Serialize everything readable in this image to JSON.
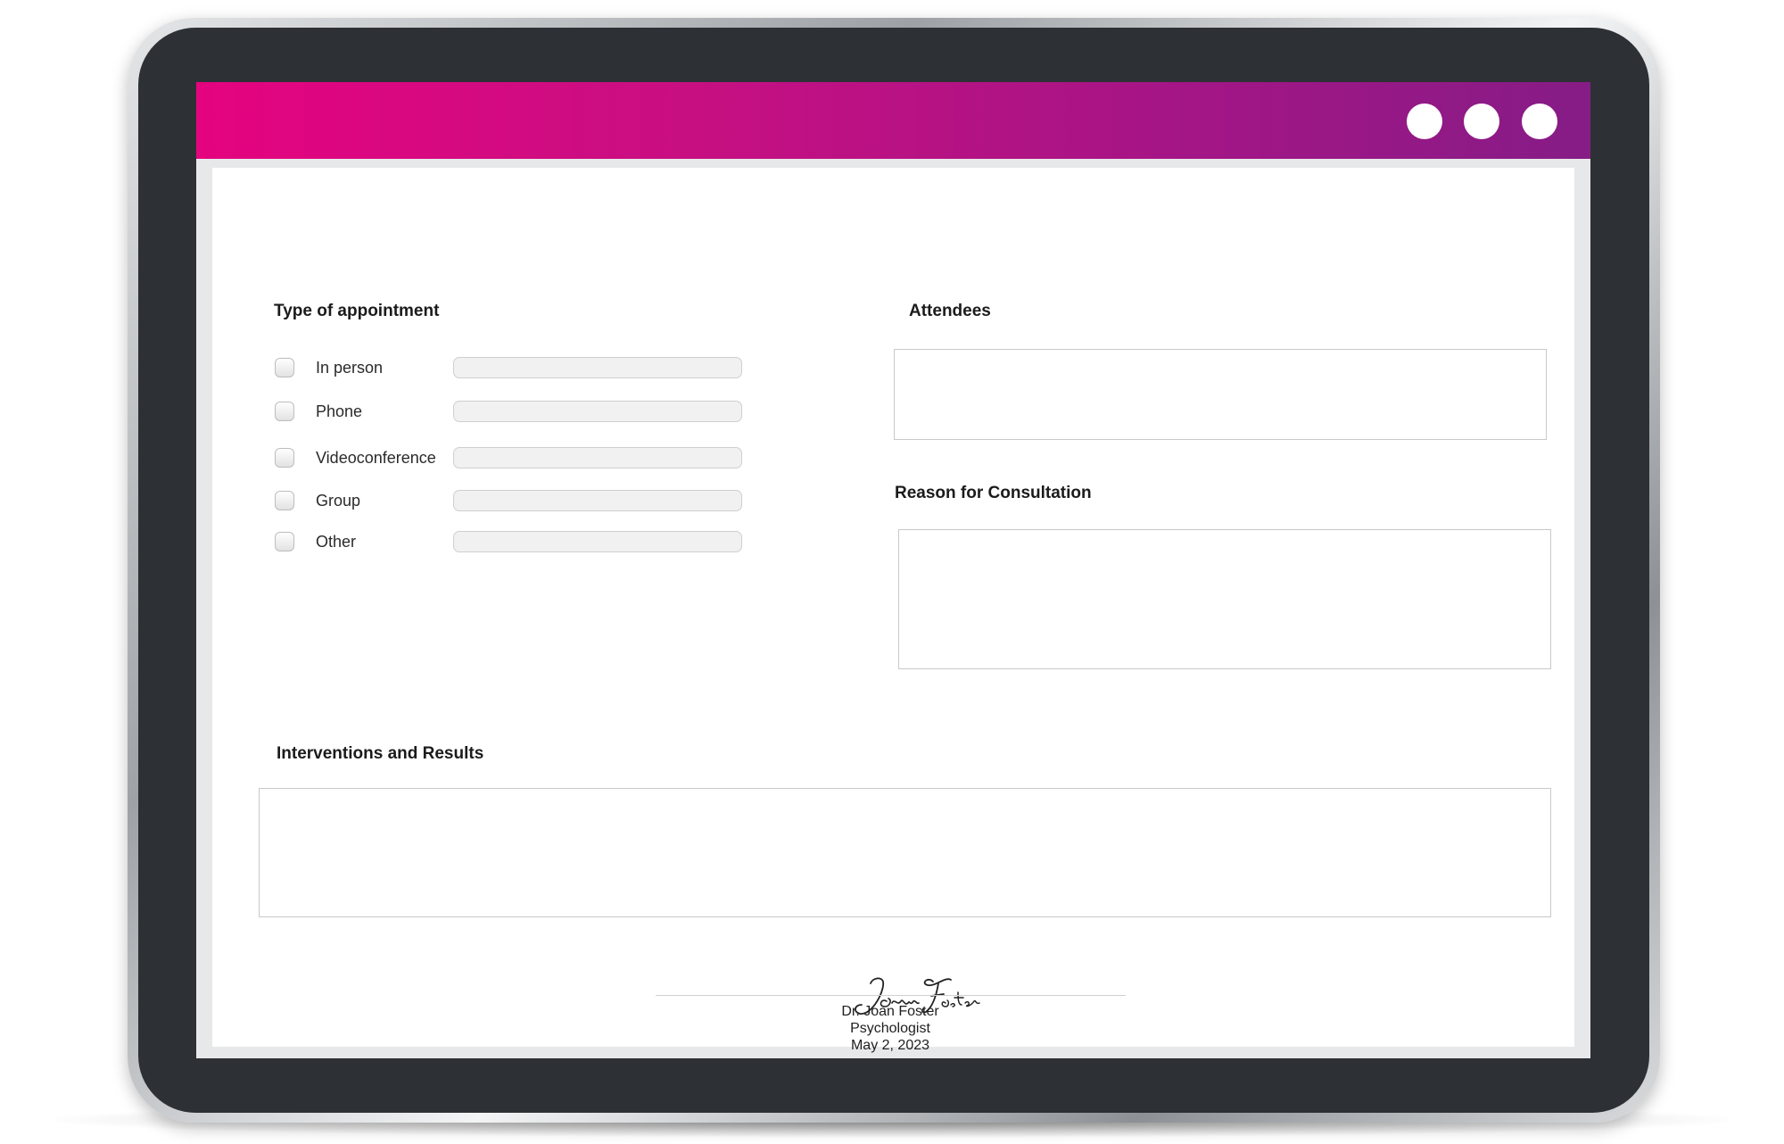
{
  "form": {
    "type_of_appointment": {
      "label": "Type of appointment",
      "options": [
        {
          "label": "In person",
          "checked": false,
          "value": ""
        },
        {
          "label": "Phone",
          "checked": false,
          "value": ""
        },
        {
          "label": "Videoconference",
          "checked": false,
          "value": ""
        },
        {
          "label": "Group",
          "checked": false,
          "value": ""
        },
        {
          "label": "Other",
          "checked": false,
          "value": ""
        }
      ]
    },
    "attendees": {
      "label": "Attendees",
      "value": ""
    },
    "reason": {
      "label": "Reason for Consultation",
      "value": ""
    },
    "interventions": {
      "label": "Interventions and Results",
      "value": ""
    }
  },
  "signature": {
    "script_text": "Joan Foster",
    "name": "Dr. Joan Foster",
    "title": "Psychologist",
    "date": "May 2, 2023"
  },
  "window_controls": [
    "dot",
    "dot",
    "dot"
  ],
  "colors": {
    "header_start": "#e5037f",
    "header_end": "#861c86",
    "bezel": "#2d3135"
  }
}
